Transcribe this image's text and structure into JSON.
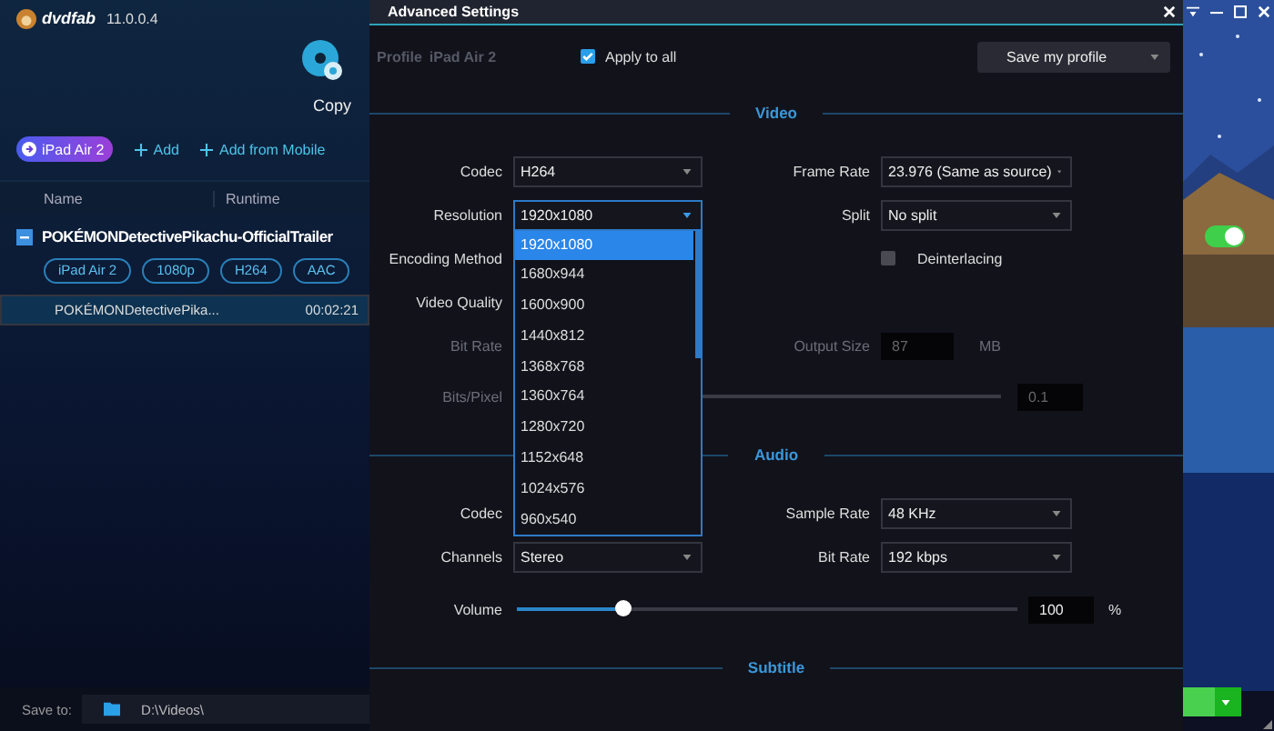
{
  "app": {
    "logo": "dvdfab",
    "version": "11.0.0.4",
    "module": "Copy",
    "toolbar": {
      "profile": "iPad Air 2",
      "add": "Add",
      "add_mobile": "Add from Mobile"
    },
    "columns": [
      "Name",
      "Runtime"
    ],
    "title": "POKÉMONDetectivePikachu-OfficialTrailer",
    "tags": [
      "iPad Air 2",
      "1080p",
      "H264",
      "AAC"
    ],
    "rows": [
      {
        "name": "POKÉMONDetectivePika...",
        "runtime": "00:02:21",
        "selected": true
      }
    ],
    "save_to": {
      "label": "Save to:",
      "path": "D:\\Videos\\"
    },
    "toggle": {
      "on": true
    }
  },
  "dialog": {
    "title": "Advanced Settings",
    "profile_label": "Profile",
    "profile_name": "iPad Air 2",
    "apply_all": {
      "label": "Apply to all",
      "checked": true
    },
    "save_button": "Save my profile",
    "sections": [
      {
        "title": "Video",
        "rows": [
          {
            "left": {
              "kind": "select",
              "label": "Codec",
              "value": "H264"
            },
            "right": {
              "kind": "select",
              "label": "Frame Rate",
              "value": "23.976 (Same as source)"
            }
          },
          {
            "left": {
              "kind": "select",
              "label": "Resolution",
              "value": "1920x1080",
              "expanded": true,
              "options": [
                {
                  "label": "1920x1080",
                  "selected": true
                },
                {
                  "label": "1680x944",
                  "selected": false
                },
                {
                  "label": "1600x900",
                  "selected": false
                },
                {
                  "label": "1440x812",
                  "selected": false
                },
                {
                  "label": "1368x768",
                  "selected": false
                },
                {
                  "label": "1360x764",
                  "selected": false
                },
                {
                  "label": "1280x720",
                  "selected": false
                },
                {
                  "label": "1152x648",
                  "selected": false
                },
                {
                  "label": "1024x576",
                  "selected": false
                },
                {
                  "label": "960x540",
                  "selected": false
                }
              ]
            },
            "right": {
              "kind": "select",
              "label": "Split",
              "value": "No split"
            }
          },
          {
            "left": {
              "kind": "label",
              "label": "Encoding Method"
            },
            "right": {
              "kind": "checkbox",
              "label": "Deinterlacing",
              "checked": false
            }
          },
          {
            "left": {
              "kind": "label",
              "label": "Video Quality"
            }
          },
          {
            "left": {
              "kind": "label",
              "label": "Bit Rate",
              "disabled": true
            },
            "right": {
              "kind": "number",
              "label": "Output Size",
              "value": "87",
              "unit": "MB",
              "disabled": true
            }
          },
          {
            "full": {
              "kind": "track",
              "label": "Bits/Pixel",
              "value": "0.1",
              "disabled": true
            }
          }
        ]
      },
      {
        "title": "Audio",
        "rows": [
          {
            "left": {
              "kind": "label",
              "label": "Codec"
            },
            "right": {
              "kind": "select",
              "label": "Sample Rate",
              "value": "48 KHz"
            }
          },
          {
            "left": {
              "kind": "select",
              "label": "Channels",
              "value": "Stereo"
            },
            "right": {
              "kind": "select",
              "label": "Bit Rate",
              "value": "192 kbps"
            }
          },
          {
            "full": {
              "kind": "slider",
              "label": "Volume",
              "level": 0.21,
              "value": "100",
              "unit": "%"
            }
          }
        ]
      },
      {
        "title": "Subtitle"
      }
    ]
  }
}
